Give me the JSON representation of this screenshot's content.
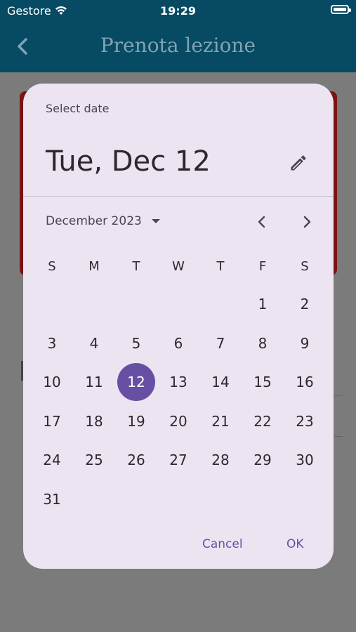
{
  "status_bar": {
    "carrier": "Gestore",
    "time": "19:29"
  },
  "app_bar": {
    "title": "Prenota lezione"
  },
  "date_picker": {
    "header": "Select date",
    "selected_display": "Tue, Dec 12",
    "month_year": "December 2023",
    "weekdays": [
      "S",
      "M",
      "T",
      "W",
      "T",
      "F",
      "S"
    ],
    "first_weekday_index": 5,
    "days": [
      "1",
      "2",
      "3",
      "4",
      "5",
      "6",
      "7",
      "8",
      "9",
      "10",
      "11",
      "12",
      "13",
      "14",
      "15",
      "16",
      "17",
      "18",
      "19",
      "20",
      "21",
      "22",
      "23",
      "24",
      "25",
      "26",
      "27",
      "28",
      "29",
      "30",
      "31"
    ],
    "selected_day": "12",
    "cancel_label": "Cancel",
    "ok_label": "OK"
  },
  "colors": {
    "app_bar": "#064a63",
    "dialog": "#ece5f1",
    "accent": "#6750a4",
    "background_card": "#7a1313"
  }
}
